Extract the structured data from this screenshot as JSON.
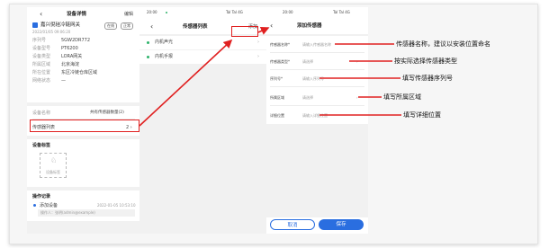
{
  "screen1": {
    "back": "‹",
    "title": "设备详情",
    "edit": "编辑",
    "device_name": "嘉兴倪硅冷链网关",
    "tag1": "在线",
    "tag2": "正常",
    "timestamp": "2022/01/05 09:06:20",
    "fields": [
      {
        "label": "序列号",
        "value": "5GW2DR772"
      },
      {
        "label": "设备型号",
        "value": "PT6200"
      },
      {
        "label": "设备类型",
        "value": "LORA网关"
      },
      {
        "label": "所属区域",
        "value": "北京海淀"
      },
      {
        "label": "所在位置",
        "value": "东区冷链仓库区域"
      },
      {
        "label": "网络状态",
        "value": "—"
      }
    ],
    "sensor_count_label": "设备名称",
    "sensor_count_value": "共有传感器数量(2)",
    "sensor_list_label": "传感器列表",
    "sensor_list_value": "2 ›",
    "labels_title": "设备标签",
    "add_tag": "设备标签",
    "ops_title": "操作记录",
    "op_item": "添加设备",
    "op_time": "2022-01-05 10:53:10",
    "op_detail": "操作人：张明(admin@example)"
  },
  "screen2": {
    "status_time": "20:00",
    "status_right": "Tal Tal 4G",
    "back": "‹",
    "title": "传感器列表",
    "add": "添加",
    "items": [
      {
        "name": "内机声光"
      },
      {
        "name": "内机手报"
      }
    ]
  },
  "screen3": {
    "status_time": "20:00",
    "status_right": "Tal Tal 4G",
    "back": "‹",
    "title": "添加传感器",
    "fields": [
      {
        "label": "传感器名称*",
        "placeholder": "请输入传感器名称"
      },
      {
        "label": "传感器类型*",
        "placeholder": "请选择"
      },
      {
        "label": "序列号*",
        "placeholder": "请输入序列号"
      },
      {
        "label": "所属区域",
        "placeholder": "请选择"
      },
      {
        "label": "详细位置",
        "placeholder": "请输入详细位置"
      }
    ],
    "cancel": "取消",
    "confirm": "保存"
  },
  "annotations": [
    "传感器名称，建议以安装位置命名",
    "按实际选择传感器类型",
    "填写传感器序列号",
    "填写所属区域",
    "填写详细位置"
  ],
  "colors": {
    "accent": "#2a6ee0",
    "annotation": "#e02020",
    "online": "#2fb36b"
  }
}
